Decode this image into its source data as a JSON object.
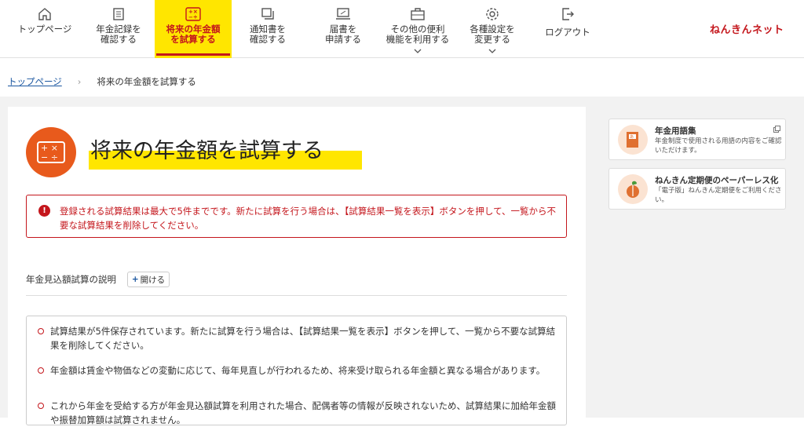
{
  "nav": {
    "items": [
      {
        "label_1": "トップページ",
        "label_2": ""
      },
      {
        "label_1": "年金記録を",
        "label_2": "確認する"
      },
      {
        "label_1": "将来の年金額",
        "label_2": "を試算する"
      },
      {
        "label_1": "通知書を",
        "label_2": "確認する"
      },
      {
        "label_1": "届書を",
        "label_2": "申請する"
      },
      {
        "label_1": "その他の便利",
        "label_2": "機能を利用する"
      },
      {
        "label_1": "各種設定を",
        "label_2": "変更する"
      },
      {
        "label_1": "ログアウト",
        "label_2": ""
      }
    ],
    "brand": "ねんきんネット"
  },
  "breadcrumb": {
    "home": "トップページ",
    "sep": "›",
    "current": "将来の年金額を試算する"
  },
  "page": {
    "title": "将来の年金額を試算する",
    "alert": "登録される試算結果は最大で5件までです。新たに試算を行う場合は、【試算結果一覧を表示】ボタンを押して、一覧から不要な試算結果を削除してください。",
    "alert_icon": "!",
    "explain_label": "年金見込額試算の説明",
    "open_button": "開ける",
    "open_plus": "+",
    "notes": [
      "試算結果が5件保存されています。新たに試算を行う場合は、【試算結果一覧を表示】ボタンを押して、一覧から不要な試算結果を削除してください。",
      "年金額は賃金や物価などの変動に応じて、毎年見直しが行われるため、将来受け取られる年金額と異なる場合があります。",
      "これから年金を受給する方が年金見込額試算を利用された場合、配偶者等の情報が反映されないため、試算結果に加給年金額や振替加算額は試算されません。"
    ]
  },
  "side": {
    "cards": [
      {
        "title": "年金用語集",
        "desc": "年金制度で使用される用語の内容をご確認いただけます。",
        "icon": "book-icon"
      },
      {
        "title": "ねんきん定期便のペーパーレス化",
        "desc": "「電子版」ねんきん定期便をご利用ください。",
        "icon": "leaf-icon"
      }
    ]
  },
  "colors": {
    "accent_red": "#c4161c",
    "highlight_yellow": "#ffe600",
    "title_icon_orange": "#e85a1c"
  }
}
